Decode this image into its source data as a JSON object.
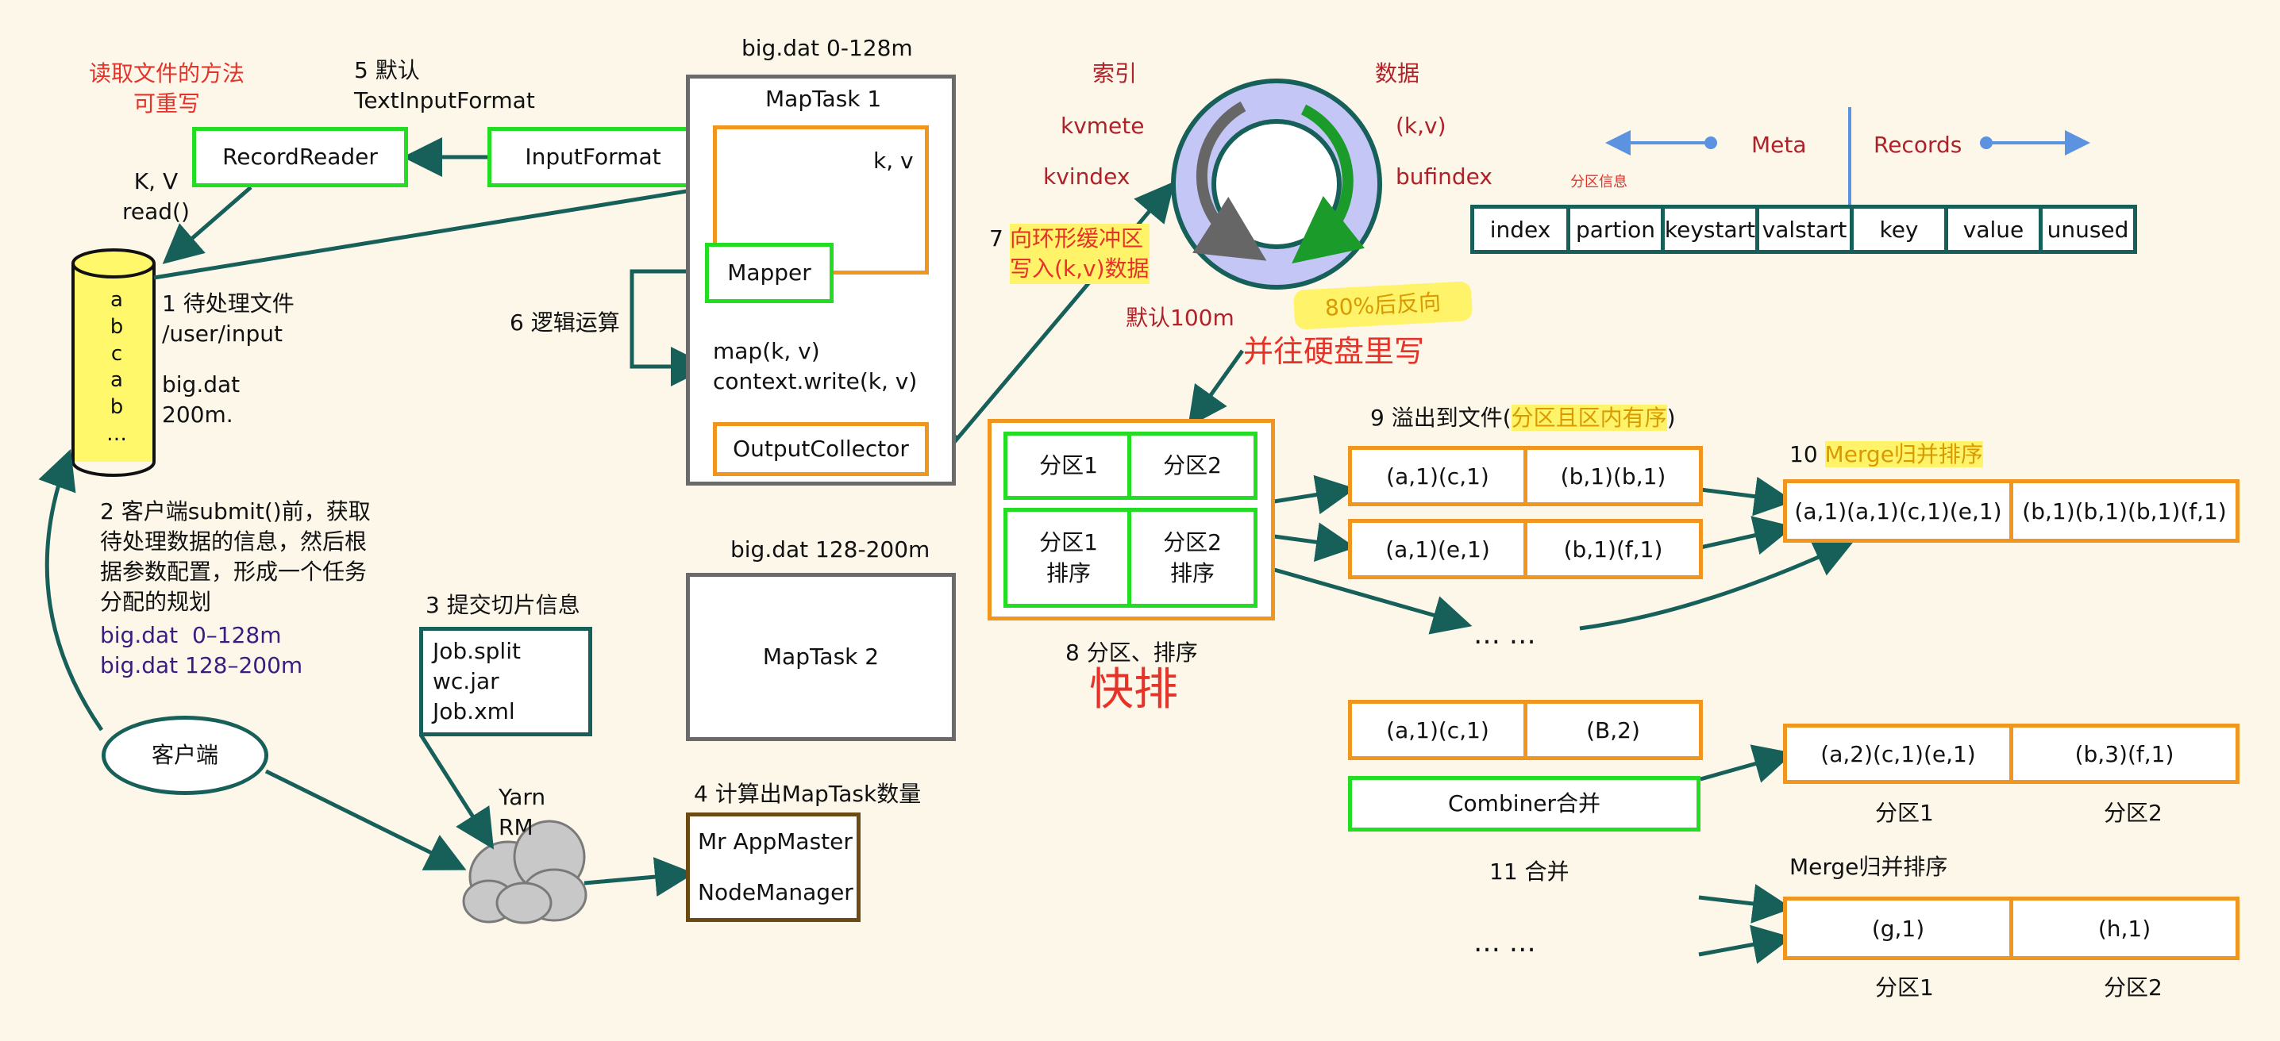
{
  "notes": {
    "read_method": "读取文件的方法\n可重写",
    "step5": "5 默认\nTextInputFormat",
    "kv_read": "K, V\nread()",
    "step1": "1 待处理文件\n/user/input",
    "file_info": "big.dat\n200m.",
    "file_contents": "a\nb\nc\na\nb\n…",
    "step2": "2 客户端submit()前，获取\n待处理数据的信息，然后根\n据参数配置，形成一个任务\n分配的规划",
    "plan": "big.dat  0–128m\nbig.dat 128–200m",
    "step3": "3 提交切片信息",
    "yarn": "Yarn\nRM",
    "step4": "4 计算出MapTask数量",
    "step6": "6 逻辑运算",
    "split1_title": "big.dat 0-128m",
    "split2_title": "big.dat 128-200m",
    "step7_num": "7 ",
    "step7_text": "向环形缓冲区\n写入(k,v)数据",
    "index_label": "索引",
    "kvmete": "kvmete",
    "kvindex": "kvindex",
    "data_label": "数据",
    "kv_pair": "(k,v)",
    "bufindex": "bufindex",
    "default100": "默认100m",
    "pct80": "80%后反向",
    "write_disk": "并往硬盘里写",
    "meta": "Meta",
    "records": "Records",
    "partition_info": "分区信息",
    "step8": "8 分区、排序",
    "quicksort": "快排",
    "step9_prefix": "9 溢出到文件(",
    "step9_hl": "分区且区内有序",
    "step9_suffix": ")",
    "step10_num": "10 ",
    "step10_text": "Merge归并排序",
    "dots": "… …",
    "step11": "11 合并",
    "merge_sort": "Merge归并排序"
  },
  "boxes": {
    "record_reader": "RecordReader",
    "input_format": "InputFormat",
    "maptask1": "MapTask 1",
    "kv": "k, v",
    "mapper": "Mapper",
    "map_fn": "map(k, v)\ncontext.write(k, v)",
    "output_collector": "OutputCollector",
    "maptask2": "MapTask 2",
    "job_files": "Job.split\nwc.jar\nJob.xml",
    "mr_appmaster": "Mr AppMaster",
    "node_manager": "NodeManager",
    "client": "客户端",
    "partition1": "分区1",
    "partition2": "分区2",
    "partition1_sort": "分区1\n排序",
    "partition2_sort": "分区2\n排序",
    "combiner": "Combiner合并"
  },
  "meta_table": [
    "index",
    "partion",
    "keystart",
    "valstart",
    "key",
    "value",
    "unused"
  ],
  "spills": [
    [
      "(a,1)(c,1)",
      "(b,1)(b,1)"
    ],
    [
      "(a,1)(e,1)",
      "(b,1)(f,1)"
    ]
  ],
  "merged": [
    "(a,1)(a,1)(c,1)(e,1)",
    "(b,1)(b,1)(b,1)(f,1)"
  ],
  "combine_in": [
    "(a,1)(c,1)",
    "(B,2)"
  ],
  "combine_out": [
    "(a,2)(c,1)(e,1)",
    "(b,3)(f,1)"
  ],
  "merge_final": [
    "(g,1)",
    "(h,1)"
  ],
  "partition_labels": [
    "分区1",
    "分区2"
  ],
  "colors": {
    "background": "#fdf7ea",
    "arrow": "#17605a",
    "green_border": "#22dd22",
    "orange_border": "#f0961e",
    "gray_border": "#6a6a6a",
    "red_text": "#e5332a",
    "dark_red_text": "#b0222a",
    "highlight": "#fff36a",
    "blue_arrow": "#5c93e0",
    "ring_fill": "#c4c6f5",
    "ring_border": "#17605a",
    "cylinder_fill": "#fff86a"
  }
}
